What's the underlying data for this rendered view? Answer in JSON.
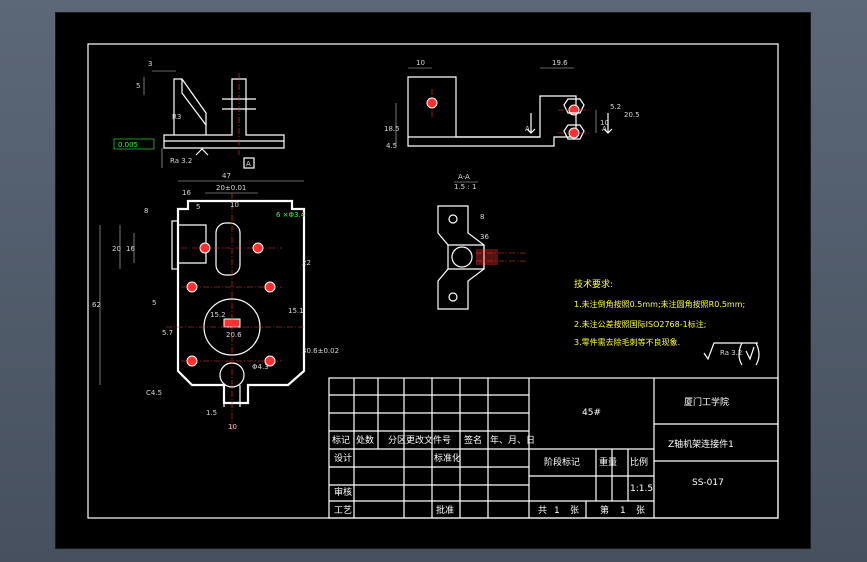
{
  "title_block": {
    "material": "45#",
    "school": "厦门工学院",
    "part_name": "Z轴机架连接件1",
    "drawing_number": "SS-017",
    "scale": "1:1.5",
    "headers": {
      "mark": "标记",
      "count": "处数",
      "zone": "分区",
      "change_no": "更改文件号",
      "signature": "签名",
      "date": "年、月、日",
      "design": "设计",
      "standardization": "标准化",
      "stage_mark": "阶段标记",
      "weight": "重量",
      "ratio": "比例",
      "review": "审核",
      "process": "工艺",
      "approve": "批准",
      "total": "共",
      "total_count": "1",
      "sheet_unit": "张",
      "sheet": "第",
      "sheet_no": "1",
      "sheet_unit2": "张"
    }
  },
  "tech_req": {
    "heading": "技术要求:",
    "line1": "1.未注倒角按照0.5mm;未注圆角按照R0.5mm;",
    "line2": "2.未注公差按照国际ISO2768-1标注;",
    "line3": "3.零件需去除毛刺等不良现象."
  },
  "roughness_note": "Ra 3.2",
  "section": {
    "label": "A-A",
    "scale": "1.5 : 1"
  },
  "datum": {
    "label": "A",
    "tolerance": "0.005",
    "arrow_label": "A"
  },
  "dims": {
    "d47": "47",
    "d20": "20±0.01",
    "d16": "16",
    "d5": "5",
    "d10": "10",
    "d8": "8",
    "d6": "6 ×Φ3.4",
    "d62": "62",
    "d20v": "20",
    "d16v": "16",
    "d22": "22",
    "d15": "15.1",
    "d30": "30.6±0.02",
    "d15_2": "15.2",
    "d20_6": "20.6",
    "d5_7": "5.7",
    "dphi4": "Φ4.3",
    "dC45": "C4.5",
    "d1_5": "1.5",
    "d10b": "10",
    "d3": "3",
    "d5t": "5",
    "d10t": "10",
    "d19_6": "19.6",
    "d10r": "10",
    "d5_2": "5.2",
    "d20_5": "20.5",
    "d18_5": "18.5",
    "d4_5": "4.5",
    "d36": "36",
    "dR": "R3",
    "d8r": "8"
  },
  "colors": {
    "background": "#000000",
    "lines": "#ffffff",
    "centerline": "#ff3030",
    "green_text": "#33ff33",
    "yellow_text": "#ffff33",
    "cyan_text": "#33ffff"
  }
}
